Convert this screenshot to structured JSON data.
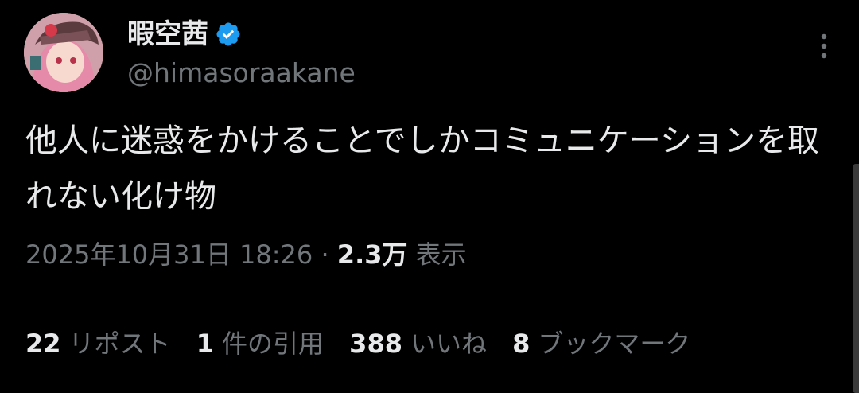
{
  "author": {
    "display_name": "暇空茜",
    "handle": "@himasoraakane",
    "verified": true
  },
  "icons": {
    "avatar": "avatar-image",
    "verified": "verified-badge-icon",
    "more": "more-options-icon"
  },
  "colors": {
    "background": "#000000",
    "text": "#e7e9ea",
    "secondary": "#71767b",
    "verified": "#1d9bf0",
    "divider": "#2f3336"
  },
  "tweet": {
    "text": "他人に迷惑をかけることでしかコミュニケーションを取れない化け物",
    "timestamp": "2025年10月31日 18:26",
    "separator": "·",
    "views_count": "2.3万",
    "views_label": "表示"
  },
  "stats": {
    "reposts": {
      "count": "22",
      "label": "リポスト"
    },
    "quotes": {
      "count": "1",
      "label": "件の引用"
    },
    "likes": {
      "count": "388",
      "label": "いいね"
    },
    "bookmarks": {
      "count": "8",
      "label": "ブックマーク"
    }
  }
}
